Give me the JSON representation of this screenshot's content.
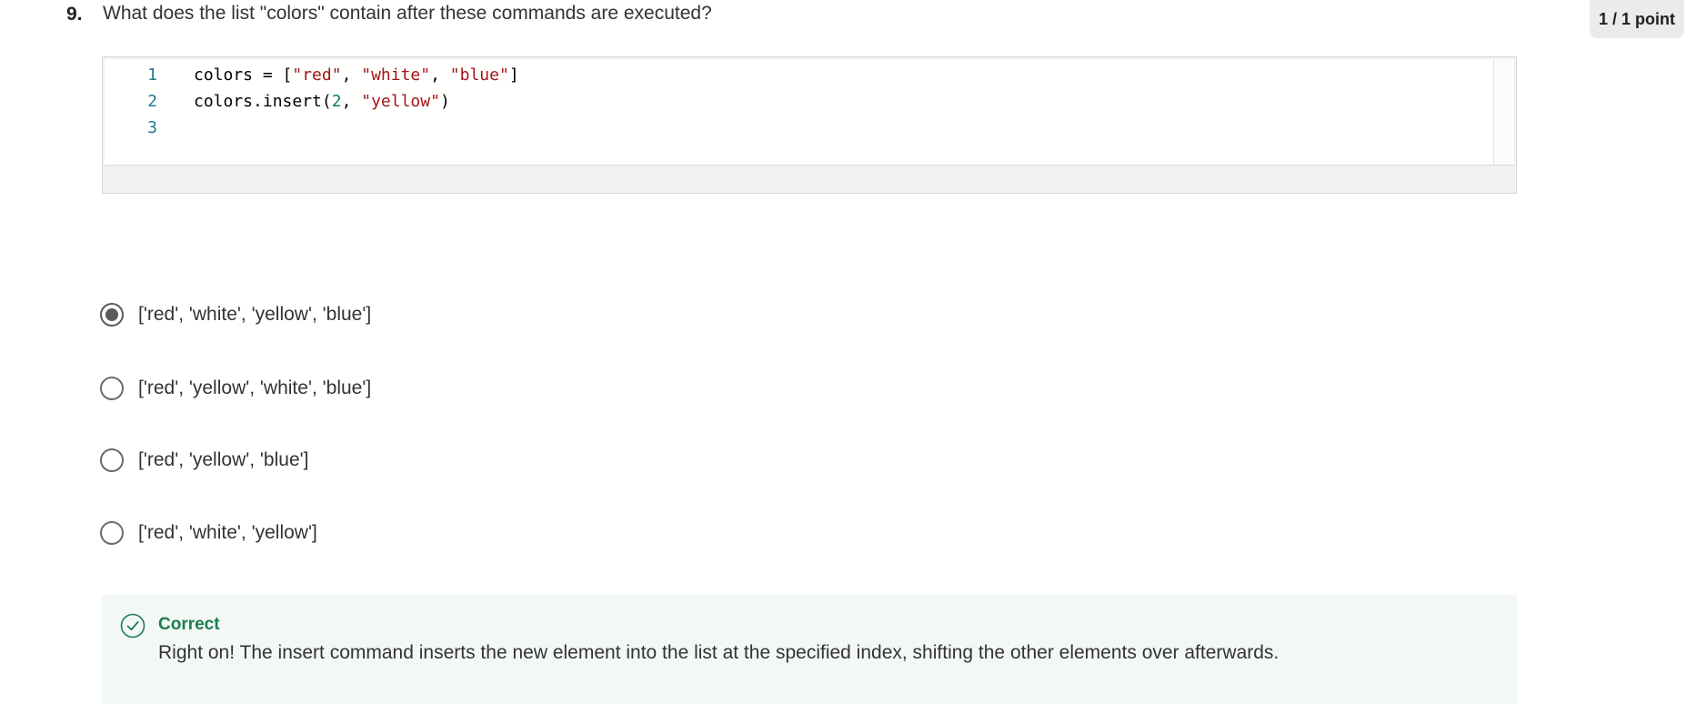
{
  "question": {
    "number": "9.",
    "text": "What does the list \"colors\" contain after these commands are executed?",
    "points": "1 / 1 point"
  },
  "code": {
    "lines": [
      {
        "num": "1",
        "tokens": [
          {
            "t": "colors = [",
            "k": "plain"
          },
          {
            "t": "\"red\"",
            "k": "str"
          },
          {
            "t": ", ",
            "k": "plain"
          },
          {
            "t": "\"white\"",
            "k": "str"
          },
          {
            "t": ", ",
            "k": "plain"
          },
          {
            "t": "\"blue\"",
            "k": "str"
          },
          {
            "t": "]",
            "k": "plain"
          }
        ]
      },
      {
        "num": "2",
        "tokens": [
          {
            "t": "colors.insert(",
            "k": "plain"
          },
          {
            "t": "2",
            "k": "num"
          },
          {
            "t": ", ",
            "k": "plain"
          },
          {
            "t": "\"yellow\"",
            "k": "str"
          },
          {
            "t": ")",
            "k": "plain"
          }
        ]
      },
      {
        "num": "3",
        "tokens": []
      }
    ]
  },
  "options": [
    {
      "label": "['red', 'white', 'yellow', 'blue']",
      "selected": true
    },
    {
      "label": "['red', 'yellow', 'white', 'blue']",
      "selected": false
    },
    {
      "label": "['red', 'yellow', 'blue']",
      "selected": false
    },
    {
      "label": "['red', 'white', 'yellow']",
      "selected": false
    }
  ],
  "feedback": {
    "icon": "check-circle-icon",
    "title": "Correct",
    "text": "Right on! The insert command inserts the new element into the list at the specified index, shifting the other elements over afterwards.",
    "color": "#1d7c50"
  }
}
